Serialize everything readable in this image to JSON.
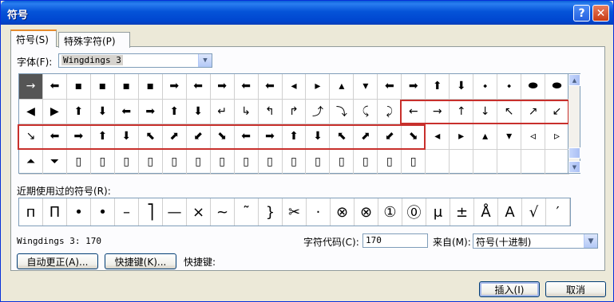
{
  "window": {
    "title": "符号",
    "help": "?",
    "close": "✕"
  },
  "tabs": [
    {
      "label": "符号(S)"
    },
    {
      "label": "特殊字符(P)"
    }
  ],
  "font": {
    "label": "字体(F):",
    "value": "Wingdings 3",
    "dropdown_arrow": "▼"
  },
  "grid": {
    "rows": [
      [
        "→",
        "⬅",
        "▪",
        "▪",
        "▪",
        "▪",
        "➡",
        "⬅",
        "➡",
        "⬅",
        "⬅",
        "◂",
        "▸",
        "▴",
        "▾",
        "⬅",
        "➡",
        "⬆",
        "⬇",
        "⬩",
        "⬩",
        "⬬",
        "⬬"
      ],
      [
        "◀",
        "▶",
        "⬆",
        "⬇",
        "⬅",
        "➡",
        "⬆",
        "⬇",
        "↵",
        "↳",
        "↰",
        "↱",
        "⤴",
        "⤵",
        "⤹",
        "⤸",
        "←",
        "→",
        "↑",
        "↓",
        "↖",
        "↗",
        "↙"
      ],
      [
        "↘",
        "⬅",
        "➡",
        "⬆",
        "⬇",
        "⬉",
        "⬈",
        "⬋",
        "⬊",
        "⬅",
        "➡",
        "⬆",
        "⬇",
        "⬉",
        "⬈",
        "⬋",
        "⬊",
        "◂",
        "▸",
        "▴",
        "▾",
        "◃",
        "▹"
      ],
      [
        "⏶",
        "⏷",
        "▯",
        "▯",
        "▯",
        "▯",
        "▯",
        "▯",
        "▯",
        "▯",
        "▯",
        "▯",
        "▯",
        "▯",
        "▯",
        "▯",
        "▯",
        "",
        "",
        "",
        "",
        "",
        ""
      ]
    ]
  },
  "recent": {
    "label": "近期使用过的符号(R):",
    "symbols": [
      "п",
      "П",
      "•",
      "•",
      "–",
      "⎤",
      "—",
      "×",
      "~",
      "˜",
      "}",
      "✂",
      "·",
      "⊗",
      "⊗",
      "①",
      "⓪",
      "μ",
      "±",
      "Å",
      "A",
      "√",
      "′"
    ]
  },
  "status": {
    "text": "Wingdings 3: 170"
  },
  "charcode": {
    "label": "字符代码(C):",
    "value": "170"
  },
  "from": {
    "label": "来自(M):",
    "value": "符号(十进制)",
    "dropdown_arrow": "▼"
  },
  "buttons": {
    "autocorrect": "自动更正(A)...",
    "shortcut_key": "快捷键(K)...",
    "shortcut_label": "快捷键:",
    "insert": "插入(I)",
    "cancel": "取消"
  },
  "scroll": {
    "up": "▲",
    "down": "▼"
  }
}
